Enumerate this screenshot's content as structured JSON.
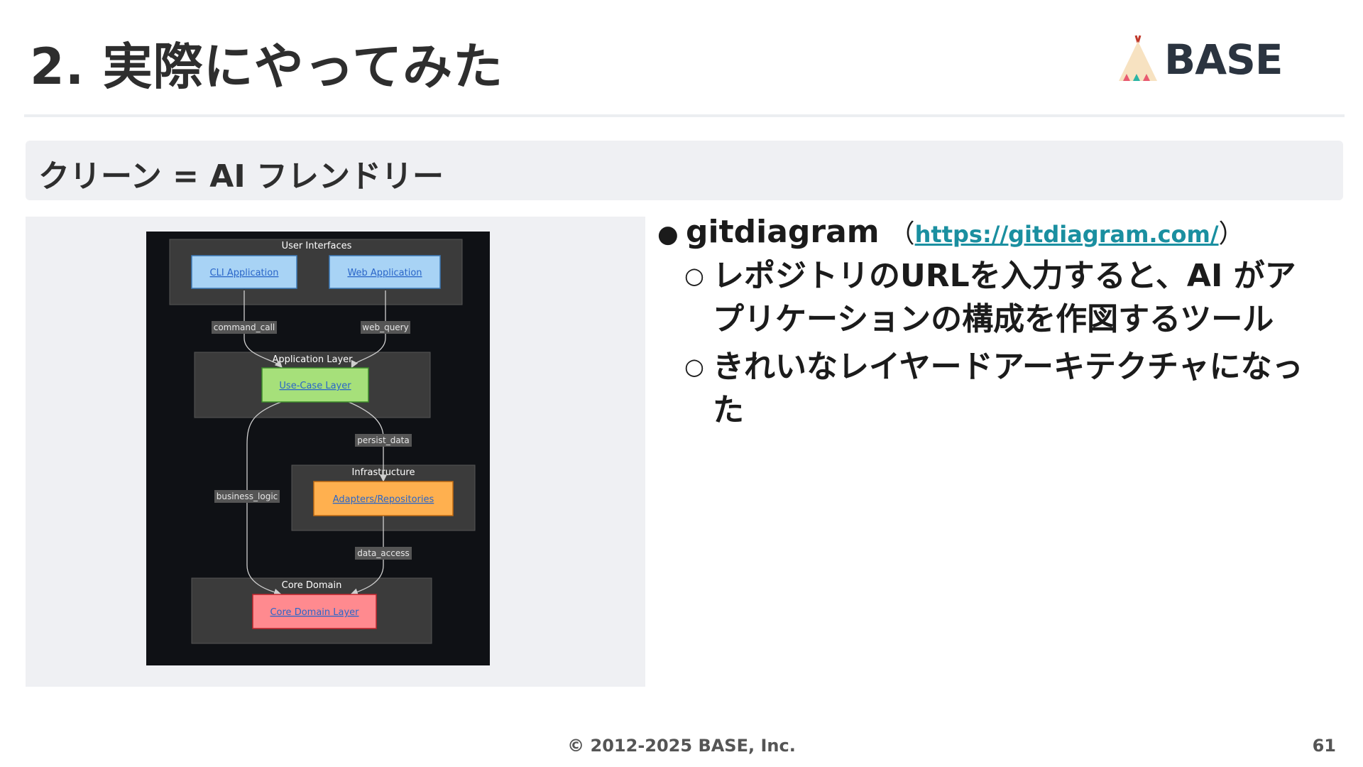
{
  "slide": {
    "title": "2. 実際にやってみた",
    "logo_text": "BASE",
    "subtitle": "クリーン = AI フレンドリー",
    "footer": "© 2012-2025 BASE, Inc.",
    "page_number": "61"
  },
  "bullets": {
    "main_label": "gitdiagram",
    "paren_open": "（",
    "link": "https://gitdiagram.com/",
    "paren_close": "）",
    "sub1": "レポジトリのURLを入力すると、AI がアプリケーションの構成を作図するツール",
    "sub2": "きれいなレイヤードアーキテクチャになった"
  },
  "diagram": {
    "groups": {
      "user_interfaces": "User Interfaces",
      "application_layer": "Application Layer",
      "infrastructure": "Infrastructure",
      "core_domain": "Core Domain"
    },
    "nodes": {
      "cli": "CLI Application",
      "web": "Web Application",
      "usecase": "Use-Case Layer",
      "adapters": "Adapters/Repositories",
      "core": "Core Domain Layer"
    },
    "edges": {
      "command_call": "command_call",
      "web_query": "web_query",
      "persist_data": "persist_data",
      "business_logic": "business_logic",
      "data_access": "data_access"
    },
    "colors": {
      "cli": "#a8d3f5",
      "web": "#a8d3f5",
      "usecase": "#a6e07a",
      "adapters": "#ffb04f",
      "core": "#ff8a8f",
      "group": "#3b3b3b",
      "background": "#0f1115"
    }
  }
}
